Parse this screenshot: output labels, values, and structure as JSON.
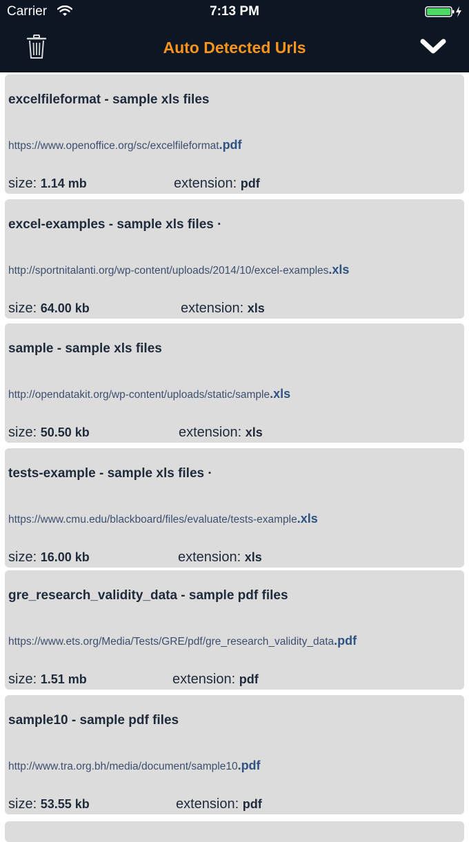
{
  "status_bar": {
    "carrier": "Carrier",
    "time": "7:13 PM"
  },
  "header": {
    "title": "Auto Detected Urls",
    "delete_icon": "trash-icon",
    "collapse_icon": "chevron-down-icon"
  },
  "colors": {
    "header_bg": "#0d1724",
    "title": "#f7941d",
    "card_bg": "#dcdcdc",
    "battery": "#4cd964"
  },
  "labels": {
    "size": "size:",
    "extension": "extension:"
  },
  "items": [
    {
      "title": "excelfileformat - sample xls files",
      "url_base": "https://www.openoffice.org/sc/excelfileformat",
      "url_ext": ".pdf",
      "size": "1.14 mb",
      "extension": "pdf"
    },
    {
      "title": "excel-examples - sample xls files ·",
      "url_base": "http://sportnitalanti.org/wp-content/uploads/2014/10/excel-examples",
      "url_ext": ".xls",
      "size": "64.00 kb",
      "extension": "xls"
    },
    {
      "title": "sample - sample xls files",
      "url_base": "http://opendatakit.org/wp-content/uploads/static/sample",
      "url_ext": ".xls",
      "size": "50.50 kb",
      "extension": "xls"
    },
    {
      "title": "tests-example - sample xls files ·",
      "url_base": "https://www.cmu.edu/blackboard/files/evaluate/tests-example",
      "url_ext": ".xls",
      "size": "16.00 kb",
      "extension": "xls"
    },
    {
      "title": "gre_research_validity_data - sample pdf files",
      "url_base": "https://www.ets.org/Media/Tests/GRE/pdf/gre_research_validity_data",
      "url_ext": ".pdf",
      "size": "1.51 mb",
      "extension": "pdf"
    },
    {
      "title": "sample10 - sample pdf files",
      "url_base": "http://www.tra.org.bh/media/document/sample10",
      "url_ext": ".pdf",
      "size": "53.55 kb",
      "extension": "pdf"
    }
  ]
}
